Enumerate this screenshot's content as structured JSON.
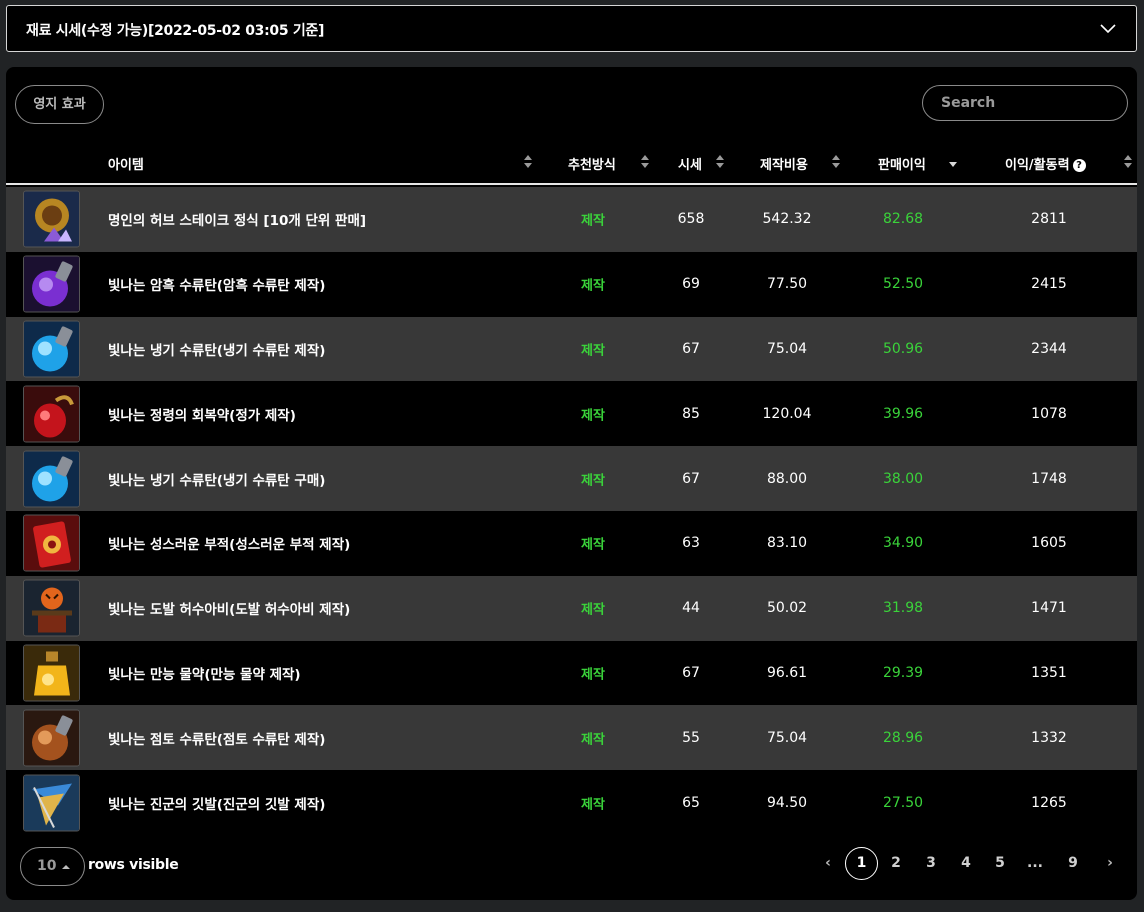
{
  "header": {
    "title": "재료 시세(수정 가능)[2022-05-02 03:05 기준]"
  },
  "toolbar": {
    "territory_button": "영지 효과",
    "search_placeholder": "Search"
  },
  "table": {
    "columns": {
      "item": "아이템",
      "method": "추천방식",
      "price": "시세",
      "cost": "제작비용",
      "profit": "판매이익",
      "ratio": "이익/활동력",
      "help": "?"
    },
    "rows": [
      {
        "name": "명인의 허브 스테이크 정식 [10개 단위 판매]",
        "method": "제작",
        "price": "658",
        "cost": "542.32",
        "profit": "82.68",
        "ratio": "2811",
        "icon": "herb-steak-icon"
      },
      {
        "name": "빛나는 암흑 수류탄(암흑 수류탄 제작)",
        "method": "제작",
        "price": "69",
        "cost": "77.50",
        "profit": "52.50",
        "ratio": "2415",
        "icon": "dark-grenade-icon"
      },
      {
        "name": "빛나는 냉기 수류탄(냉기 수류탄 제작)",
        "method": "제작",
        "price": "67",
        "cost": "75.04",
        "profit": "50.96",
        "ratio": "2344",
        "icon": "frost-grenade-icon"
      },
      {
        "name": "빛나는 정령의 회복약(정가 제작)",
        "method": "제작",
        "price": "85",
        "cost": "120.04",
        "profit": "39.96",
        "ratio": "1078",
        "icon": "spirit-potion-icon"
      },
      {
        "name": "빛나는 냉기 수류탄(냉기 수류탄 구매)",
        "method": "제작",
        "price": "67",
        "cost": "88.00",
        "profit": "38.00",
        "ratio": "1748",
        "icon": "frost-grenade-icon"
      },
      {
        "name": "빛나는 성스러운 부적(성스러운 부적 제작)",
        "method": "제작",
        "price": "63",
        "cost": "83.10",
        "profit": "34.90",
        "ratio": "1605",
        "icon": "holy-charm-icon"
      },
      {
        "name": "빛나는 도발 허수아비(도발 허수아비 제작)",
        "method": "제작",
        "price": "44",
        "cost": "50.02",
        "profit": "31.98",
        "ratio": "1471",
        "icon": "scarecrow-icon"
      },
      {
        "name": "빛나는 만능 물약(만능 물약 제작)",
        "method": "제작",
        "price": "67",
        "cost": "96.61",
        "profit": "29.39",
        "ratio": "1351",
        "icon": "panacea-icon"
      },
      {
        "name": "빛나는 점토 수류탄(점토 수류탄 제작)",
        "method": "제작",
        "price": "55",
        "cost": "75.04",
        "profit": "28.96",
        "ratio": "1332",
        "icon": "clay-grenade-icon"
      },
      {
        "name": "빛나는 진군의 깃발(진군의 깃발 제작)",
        "method": "제작",
        "price": "65",
        "cost": "94.50",
        "profit": "27.50",
        "ratio": "1265",
        "icon": "march-flag-icon"
      }
    ]
  },
  "footer": {
    "rows_value": "10",
    "rows_label": "rows visible",
    "pages": [
      "1",
      "2",
      "3",
      "4",
      "5",
      "...",
      "9"
    ],
    "prev": "‹",
    "next": "›",
    "current_page": "1"
  },
  "colors": {
    "profit_green": "#3ad33a",
    "row_alt": "#383838",
    "background": "#212325"
  }
}
